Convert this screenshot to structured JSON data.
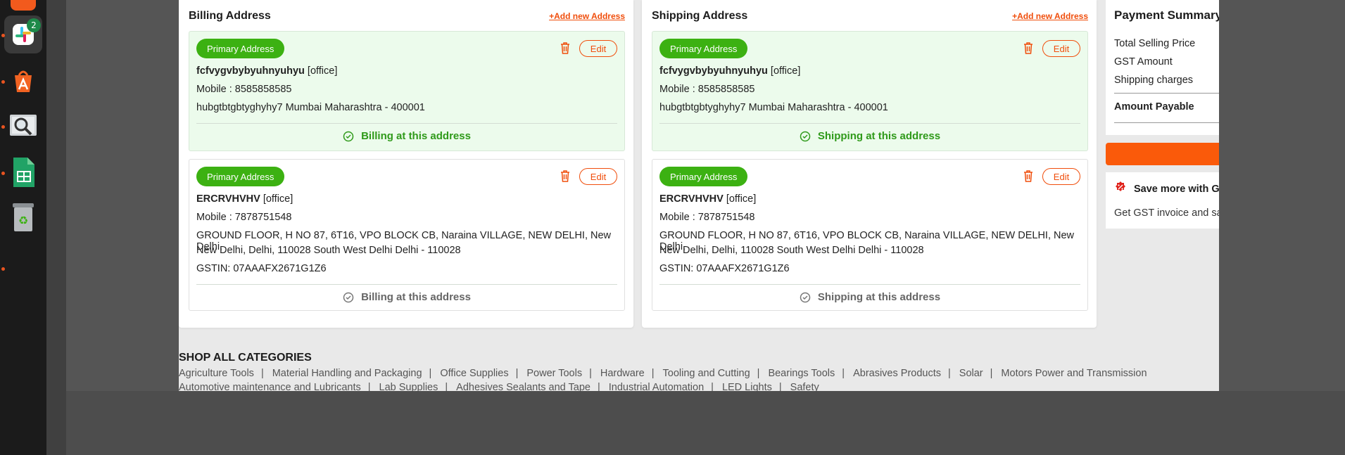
{
  "dock": {
    "slack_badge": "2"
  },
  "billing": {
    "title": "Billing Address",
    "add_link": "+Add new Address",
    "cards": [
      {
        "badge": "Primary Address",
        "edit": "Edit",
        "name": "fcfvygvbybyuhnyuhyu",
        "type": "[office]",
        "mobile": "Mobile : 8585858585",
        "address_1": "hubgtbtgbtyghyhy7 Mumbai Maharashtra - 400001",
        "action": "Billing at this address"
      },
      {
        "badge": "Primary Address",
        "edit": "Edit",
        "name": "ERCRVHVHV",
        "type": "[office]",
        "mobile": "Mobile : 7878751548",
        "address_1": "GROUND FLOOR, H NO 87, 6T16, VPO BLOCK CB, Naraina VILLAGE, NEW DELHI, New Delhi,",
        "address_2": "New Delhi, Delhi, 110028 South West Delhi Delhi - 110028",
        "gstin": "GSTIN: 07AAAFX2671G1Z6",
        "action": "Billing at this address"
      }
    ]
  },
  "shipping": {
    "title": "Shipping Address",
    "add_link": "+Add new Address",
    "cards": [
      {
        "badge": "Primary Address",
        "edit": "Edit",
        "name": "fcfvygvbybyuhnyuhyu",
        "type": "[office]",
        "mobile": "Mobile : 8585858585",
        "address_1": "hubgtbtgbtyghyhy7 Mumbai Maharashtra - 400001",
        "action": "Shipping at this address"
      },
      {
        "badge": "Primary Address",
        "edit": "Edit",
        "name": "ERCRVHVHV",
        "type": "[office]",
        "mobile": "Mobile : 7878751548",
        "address_1": "GROUND FLOOR, H NO 87, 6T16, VPO BLOCK CB, Naraina VILLAGE, NEW DELHI, New Delhi,",
        "address_2": "New Delhi, Delhi, 110028 South West Delhi Delhi - 110028",
        "gstin": "GSTIN: 07AAAFX2671G1Z6",
        "action": "Shipping at this address"
      }
    ]
  },
  "summary": {
    "title": "Payment Summary",
    "rows": [
      "Total Selling Price",
      "GST Amount",
      "Shipping charges"
    ],
    "total": "Amount Payable",
    "save_title": "Save more with GST",
    "save_text": "Get GST invoice and save"
  },
  "categories": {
    "title": "SHOP ALL CATEGORIES",
    "row1": [
      "Agriculture Tools",
      "Material Handling and Packaging",
      "Office Supplies",
      "Power Tools",
      "Hardware",
      "Tooling and Cutting",
      "Bearings Tools",
      "Abrasives Products",
      "Solar",
      "Motors Power and Transmission"
    ],
    "row2": [
      "Automotive maintenance and Lubricants",
      "Lab Supplies",
      "Adhesives Sealants and Tape",
      "Industrial Automation",
      "LED Lights",
      "Safety"
    ]
  },
  "colors": {
    "accent": "#f04e0c",
    "primary_green": "#3cb112",
    "selected_bg": "#ecfbec"
  }
}
